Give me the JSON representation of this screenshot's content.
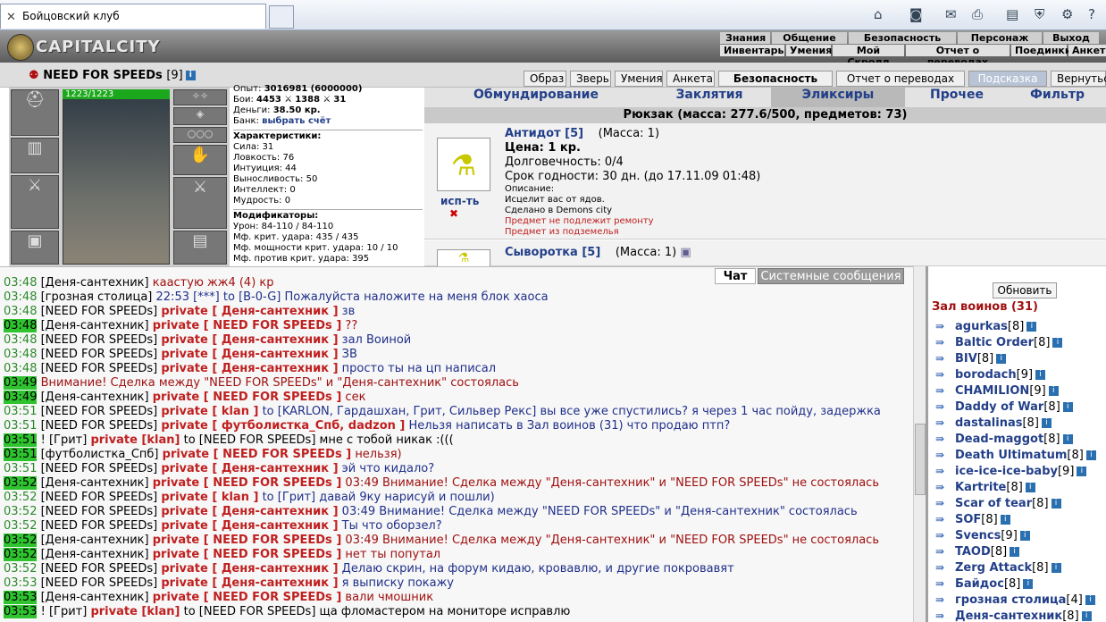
{
  "browser": {
    "tab_title": "Бойцовский клуб"
  },
  "site": {
    "logo": "CAPITALCITY",
    "menu_top": [
      "Знания",
      "Общение",
      "Безопасность",
      "Персонаж",
      "Выход"
    ],
    "menu_bottom": [
      "Инвентарь",
      "Умения",
      "Мой Скролл",
      "Отчет о переводах",
      "Поединки",
      "Анкет"
    ]
  },
  "toolbar": {
    "buttons": [
      "Образ",
      "Зверь",
      "Умения",
      "Анкета",
      "Безопасность",
      "Отчет о переводах",
      "Подсказка",
      "Вернуться"
    ]
  },
  "character": {
    "name": "NEED FOR SPEEDs",
    "level": "[9]",
    "hp": "1223/1223",
    "stats": {
      "exp_label": "Опыт:",
      "exp": "3016981",
      "exp_next": "(6000000)",
      "fights_label": "Бои:",
      "wins": "4453",
      "losses": "1388",
      "draws": "31",
      "money_label": "Деньги:",
      "money": "38.50 кр.",
      "bank_label": "Банк:",
      "bank": "выбрать счёт",
      "char_header": "Характеристики:",
      "chars": [
        "Сила: 31",
        "Ловкость: 76",
        "Интуиция: 44",
        "Выносливость: 50",
        "Интеллект: 0",
        "Мудрость: 0"
      ],
      "mod_header": "Модификаторы:",
      "mods": [
        "Урон: 84-110 / 84-110",
        "Мф. крит. удара: 435 / 435",
        "Мф. мощности крит. удара: 10 / 10",
        "Мф. против крит. удара: 395"
      ]
    }
  },
  "inventory": {
    "tabs": [
      "Обмундирование",
      "Заклятия",
      "Эликсиры",
      "Прочее",
      "Фильтр"
    ],
    "active_tab": "Эликсиры",
    "header": "Рюкзак (масса: 277.6/500, предметов: 73)",
    "items": [
      {
        "name": "Антидот [5]",
        "mass": "(Масса: 1)",
        "use": "исп-ть",
        "lines": [
          "Цена: 1 кр.",
          "Долговечность: 0/4",
          "Срок годности: 30 дн. (до 17.11.09 01:48)"
        ],
        "desc": [
          "Описание:",
          "Исцелит вас от ядов.",
          "Сделано в Demons city"
        ],
        "warn": [
          "Предмет не подлежит ремонту",
          "Предмет из подземелья"
        ]
      },
      {
        "name": "Сыворотка [5]",
        "mass": "(Масса: 1)"
      }
    ]
  },
  "chat": {
    "tabs": [
      "Чат",
      "Системные сообщения"
    ],
    "lines": [
      {
        "t": "03:48",
        "h": false,
        "n": "[Деня-сантехник]",
        "p": "",
        "m": "каастую жж4 (4) кр",
        "c": "rd"
      },
      {
        "t": "03:48",
        "h": false,
        "n": "[грозная столица]",
        "p": "",
        "m": "22:53 [***] to [B-0-G] Пожалуйста наложите на меня блок хаоса",
        "c": "bl"
      },
      {
        "t": "03:48",
        "h": false,
        "n": "[NEED FOR SPEEDs]",
        "p": "private [ Деня-сантехник ]",
        "m": "зв",
        "c": "bl"
      },
      {
        "t": "03:48",
        "h": true,
        "n": "[Деня-сантехник]",
        "p": "private [ NEED FOR SPEEDs ]",
        "m": "??",
        "c": "rd"
      },
      {
        "t": "03:48",
        "h": false,
        "n": "[NEED FOR SPEEDs]",
        "p": "private [ Деня-сантехник ]",
        "m": "зал Воиной",
        "c": "bl"
      },
      {
        "t": "03:48",
        "h": false,
        "n": "[NEED FOR SPEEDs]",
        "p": "private [ Деня-сантехник ]",
        "m": "ЗВ",
        "c": "bl"
      },
      {
        "t": "03:48",
        "h": false,
        "n": "[NEED FOR SPEEDs]",
        "p": "private [ Деня-сантехник ]",
        "m": "просто ты на цп написал",
        "c": "bl"
      },
      {
        "t": "03:49",
        "h": true,
        "n": "",
        "p": "",
        "m": "Внимание! Сделка между \"NEED FOR SPEEDs\" и \"Деня-сантехник\" состоялась",
        "c": "sys"
      },
      {
        "t": "03:49",
        "h": true,
        "n": "[Деня-сантехник]",
        "p": "private [ NEED FOR SPEEDs ]",
        "m": "сек",
        "c": "rd"
      },
      {
        "t": "03:51",
        "h": false,
        "n": "[NEED FOR SPEEDs]",
        "p": "private [ klan ]",
        "m": "to [KARLON, Гардашхан, Грит, Сильвер Рекс] вы все уже спустились? я через 1 час пойду, задержка",
        "c": "bl"
      },
      {
        "t": "03:51",
        "h": false,
        "n": "[NEED FOR SPEEDs]",
        "p": "private [ футболистка_Спб, dadzon ]",
        "m": "Нельзя написать в Зал воинов (31) что продаю птп?",
        "c": "bl"
      },
      {
        "t": "03:51",
        "h": true,
        "n": "! [Грит]",
        "p": "private [klan]",
        "m": "to [NEED FOR SPEEDs] мне с тобой никак :(((",
        "c": "n"
      },
      {
        "t": "03:51",
        "h": true,
        "n": "[футболистка_Спб]",
        "p": "private [ NEED FOR SPEEDs ]",
        "m": "нельзя)",
        "c": "rd"
      },
      {
        "t": "03:51",
        "h": false,
        "n": "[NEED FOR SPEEDs]",
        "p": "private [ Деня-сантехник ]",
        "m": "эй что кидало?",
        "c": "bl"
      },
      {
        "t": "03:52",
        "h": true,
        "n": "[Деня-сантехник]",
        "p": "private [ NEED FOR SPEEDs ]",
        "m": "03:49 Внимание! Сделка между \"Деня-сантехник\" и \"NEED FOR SPEEDs\" не состоялась",
        "c": "rd"
      },
      {
        "t": "03:52",
        "h": false,
        "n": "[NEED FOR SPEEDs]",
        "p": "private [ klan ]",
        "m": "to [Грит] давай 9ку нарисуй и пошли)",
        "c": "bl"
      },
      {
        "t": "03:52",
        "h": false,
        "n": "[NEED FOR SPEEDs]",
        "p": "private [ Деня-сантехник ]",
        "m": "03:49 Внимание! Сделка между \"NEED FOR SPEEDs\" и \"Деня-сантехник\" состоялась",
        "c": "bl"
      },
      {
        "t": "03:52",
        "h": false,
        "n": "[NEED FOR SPEEDs]",
        "p": "private [ Деня-сантехник ]",
        "m": "Ты что оборзел?",
        "c": "bl"
      },
      {
        "t": "03:52",
        "h": true,
        "n": "[Деня-сантехник]",
        "p": "private [ NEED FOR SPEEDs ]",
        "m": "03:49 Внимание! Сделка между \"Деня-сантехник\" и \"NEED FOR SPEEDs\" не состоялась",
        "c": "rd"
      },
      {
        "t": "03:52",
        "h": true,
        "n": "[Деня-сантехник]",
        "p": "private [ NEED FOR SPEEDs ]",
        "m": "нет ты попутал",
        "c": "rd"
      },
      {
        "t": "03:52",
        "h": false,
        "n": "[NEED FOR SPEEDs]",
        "p": "private [ Деня-сантехник ]",
        "m": "Делаю скрин, на форум кидаю, кровавлю, и другие покровавят",
        "c": "bl"
      },
      {
        "t": "03:53",
        "h": false,
        "n": "[NEED FOR SPEEDs]",
        "p": "private [ Деня-сантехник ]",
        "m": "я выписку покажу",
        "c": "bl"
      },
      {
        "t": "03:53",
        "h": true,
        "n": "[Деня-сантехник]",
        "p": "private [ NEED FOR SPEEDs ]",
        "m": "вали чмошник",
        "c": "rd"
      },
      {
        "t": "03:53",
        "h": true,
        "n": "! [Грит]",
        "p": "private [klan]",
        "m": "to [NEED FOR SPEEDs] ща фломастером на мониторе исправлю",
        "c": "n"
      }
    ]
  },
  "online": {
    "refresh": "Обновить",
    "room": "Зал воинов (31)",
    "users": [
      [
        "agurkas",
        "[8]"
      ],
      [
        "Baltic Order",
        "[8]"
      ],
      [
        "BIV",
        "[8]"
      ],
      [
        "borodach",
        "[9]"
      ],
      [
        "CHAMILION",
        "[9]"
      ],
      [
        "Daddy of War",
        "[8]"
      ],
      [
        "dastalinas",
        "[8]"
      ],
      [
        "Dead-maggot",
        "[8]"
      ],
      [
        "Death Ultimatum",
        "[8]"
      ],
      [
        "ice-ice-ice-baby",
        "[9]"
      ],
      [
        "Kartrite",
        "[8]"
      ],
      [
        "Scar of tear",
        "[8]"
      ],
      [
        "SOF",
        "[8]"
      ],
      [
        "Svencs",
        "[9]"
      ],
      [
        "TAOD",
        "[8]"
      ],
      [
        "Zerg Attack",
        "[8]"
      ],
      [
        "Байдос",
        "[8]"
      ],
      [
        "грозная столица",
        "[4]"
      ],
      [
        "Деня-сантехник",
        "[8]"
      ]
    ]
  }
}
